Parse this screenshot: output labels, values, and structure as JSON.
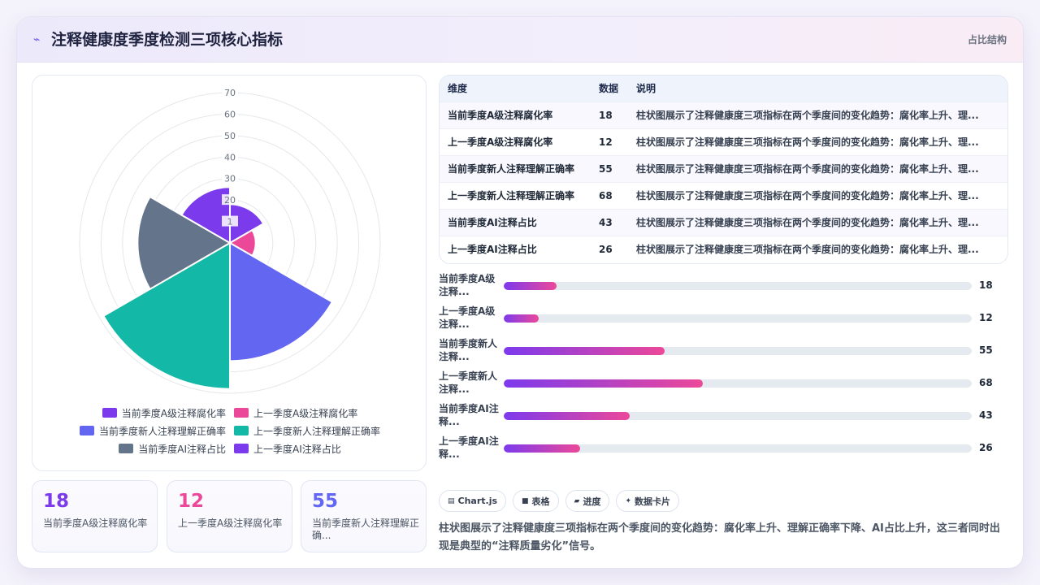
{
  "header": {
    "title": "注释健康度季度检测三项核心指标",
    "tag": "占比结构",
    "icon": "sparkle-icon"
  },
  "chart_data": {
    "type": "polarArea",
    "categories": [
      "当前季度A级注释腐化率",
      "上一季度A级注释腐化率",
      "当前季度新人注释理解正确率",
      "上一季度新人注释理解正确率",
      "当前季度AI注释占比",
      "上一季度AI注释占比"
    ],
    "values": [
      18,
      12,
      55,
      68,
      43,
      26
    ],
    "colors": [
      "#7c3aed",
      "#ec4899",
      "#6366f1",
      "#14b8a6",
      "#64748b",
      "#7c3aed"
    ],
    "r_ticks": [
      "1",
      "20",
      "30",
      "40",
      "50",
      "60",
      "70"
    ],
    "rlim": [
      0,
      70
    ],
    "legend_position": "bottom",
    "grid": true
  },
  "legend": {
    "rows": [
      [
        {
          "label": "当前季度A级注释腐化率",
          "color": "#7c3aed"
        },
        {
          "label": "上一季度A级注释腐化率",
          "color": "#ec4899"
        }
      ],
      [
        {
          "label": "当前季度新人注释理解正确率",
          "color": "#6366f1"
        },
        {
          "label": "上一季度新人注释理解正确率",
          "color": "#14b8a6"
        }
      ],
      [
        {
          "label": "当前季度AI注释占比",
          "color": "#64748b"
        },
        {
          "label": "上一季度AI注释占比",
          "color": "#7c3aed"
        }
      ]
    ]
  },
  "kpis": [
    {
      "value": "18",
      "label": "当前季度A级注释腐化率",
      "color": "#7c3aed"
    },
    {
      "value": "12",
      "label": "上一季度A级注释腐化率",
      "color": "#ec4899"
    },
    {
      "value": "55",
      "label": "当前季度新人注释理解正确...",
      "color": "#6366f1"
    }
  ],
  "table": {
    "headers": [
      "维度",
      "数据",
      "说明"
    ],
    "rows": [
      [
        "当前季度A级注释腐化率",
        "18",
        "柱状图展示了注释健康度三项指标在两个季度间的变化趋势：腐化率上升、理..."
      ],
      [
        "上一季度A级注释腐化率",
        "12",
        "柱状图展示了注释健康度三项指标在两个季度间的变化趋势：腐化率上升、理..."
      ],
      [
        "当前季度新人注释理解正确率",
        "55",
        "柱状图展示了注释健康度三项指标在两个季度间的变化趋势：腐化率上升、理..."
      ],
      [
        "上一季度新人注释理解正确率",
        "68",
        "柱状图展示了注释健康度三项指标在两个季度间的变化趋势：腐化率上升、理..."
      ],
      [
        "当前季度AI注释占比",
        "43",
        "柱状图展示了注释健康度三项指标在两个季度间的变化趋势：腐化率上升、理..."
      ],
      [
        "上一季度AI注释占比",
        "26",
        "柱状图展示了注释健康度三项指标在两个季度间的变化趋势：腐化率上升、理..."
      ]
    ]
  },
  "progress": [
    {
      "label": "当前季度A级注释...",
      "value": 18,
      "display": "18"
    },
    {
      "label": "上一季度A级注释...",
      "value": 12,
      "display": "12"
    },
    {
      "label": "当前季度新人注释...",
      "value": 55,
      "display": "55"
    },
    {
      "label": "上一季度新人注释...",
      "value": 68,
      "display": "68"
    },
    {
      "label": "当前季度AI注释...",
      "value": 43,
      "display": "43"
    },
    {
      "label": "上一季度AI注释...",
      "value": 26,
      "display": "26"
    }
  ],
  "progress_max": 160,
  "chips": [
    {
      "label": "Chart.js",
      "icon": "chart-icon",
      "glyph": "▤"
    },
    {
      "label": "表格",
      "icon": "table-icon",
      "glyph": "■"
    },
    {
      "label": "进度",
      "icon": "progress-icon",
      "glyph": "▰"
    },
    {
      "label": "数据卡片",
      "icon": "card-icon",
      "glyph": "✦"
    }
  ],
  "summary": "柱状图展示了注释健康度三项指标在两个季度间的变化趋势：腐化率上升、理解正确率下降、AI占比上升，这三者同时出现是典型的“注释质量劣化”信号。"
}
